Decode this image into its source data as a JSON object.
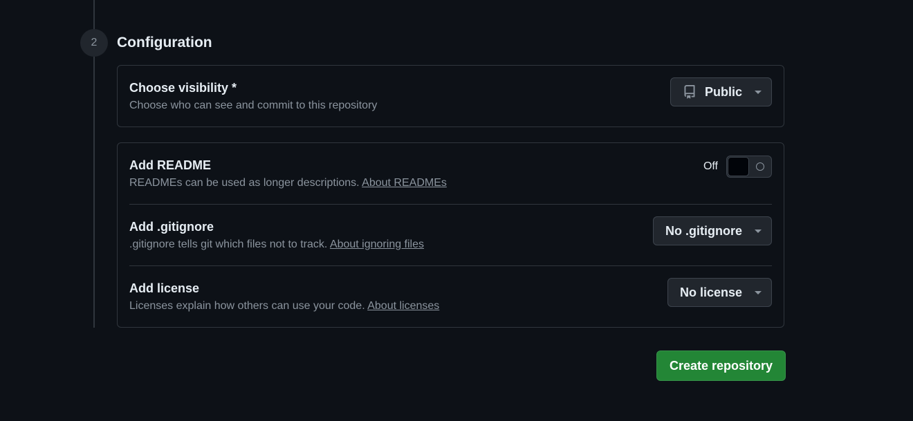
{
  "step": {
    "number": "2",
    "title": "Configuration"
  },
  "visibility": {
    "title": "Choose visibility *",
    "description": "Choose who can see and commit to this repository",
    "selected": "Public",
    "icon": "repo-icon"
  },
  "readme": {
    "title": "Add README",
    "description": "READMEs can be used as longer descriptions.",
    "link": "About READMEs",
    "toggle_state": "Off"
  },
  "gitignore": {
    "title": "Add .gitignore",
    "description": ".gitignore tells git which files not to track.",
    "link": "About ignoring files",
    "selected": "No .gitignore"
  },
  "license": {
    "title": "Add license",
    "description": "Licenses explain how others can use your code.",
    "link": "About licenses",
    "selected": "No license"
  },
  "actions": {
    "create_label": "Create repository"
  },
  "colors": {
    "background": "#0d1117",
    "border": "#30363d",
    "primary_button": "#238636",
    "muted_text": "#8b949e"
  }
}
